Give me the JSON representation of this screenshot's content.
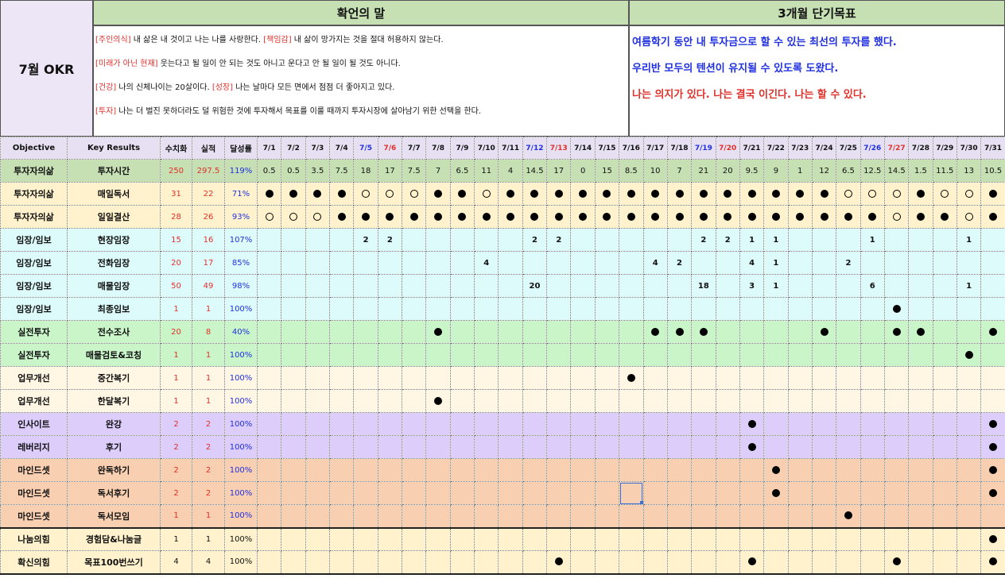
{
  "header": {
    "okr_title": "7월 OKR",
    "confirm_title": "확언의 말",
    "goal_title": "3개월 단기목표",
    "confirm_lines": [
      [
        {
          "t": "[주인의식]",
          "red": true
        },
        {
          "t": " 내 삶은 내 것이고 나는 나를 사랑한다. ",
          "red": false
        },
        {
          "t": "[책임감]",
          "red": true
        },
        {
          "t": " 내 삶이 망가지는 것을 절대 허용하지 않는다.",
          "red": false
        }
      ],
      [
        {
          "t": "[미래가 아닌 현재]",
          "red": true
        },
        {
          "t": " 웃는다고 될 일이 안 되는 것도 아니고 운다고 안 될 일이 될 것도 아니다.",
          "red": false
        }
      ],
      [
        {
          "t": "[건강]",
          "red": true
        },
        {
          "t": " 나의 신체나이는 20살이다. ",
          "red": false
        },
        {
          "t": "[성장]",
          "red": true
        },
        {
          "t": " 나는 날마다 모든 면에서 점점 더 좋아지고 있다.",
          "red": false
        }
      ],
      [
        {
          "t": "[투자]",
          "red": true
        },
        {
          "t": " 나는 더 벌진 못하더라도 덜 위험한 것에 투자해서 목표를 이룰 때까지 투자시장에 살아남기 위한 선택을 한다.",
          "red": false
        }
      ]
    ],
    "goals": [
      {
        "text": "여름학기 동안 내 투자금으로 할 수 있는 최선의 투자를 했다.",
        "color": "#2030e0"
      },
      {
        "text": "우리반 모두의 텐션이 유지될 수 있도록 도왔다.",
        "color": "#2030e0"
      },
      {
        "text": "나는 의지가 있다. 나는 결국 이긴다. 나는 할 수 있다.",
        "color": "#e0302a"
      }
    ]
  },
  "columns": {
    "objective": "Objective",
    "key_results": "Key Results",
    "numeric": "수치화",
    "actual": "실적",
    "rate": "달성률"
  },
  "dates": [
    "7/1",
    "7/2",
    "7/3",
    "7/4",
    "7/5",
    "7/6",
    "7/7",
    "7/8",
    "7/9",
    "7/10",
    "7/11",
    "7/12",
    "7/13",
    "7/14",
    "7/15",
    "7/16",
    "7/17",
    "7/18",
    "7/19",
    "7/20",
    "7/21",
    "7/22",
    "7/23",
    "7/24",
    "7/25",
    "7/26",
    "7/27",
    "7/28",
    "7/29",
    "7/30",
    "7/31"
  ],
  "date_colors": {
    "sat": [
      4,
      11,
      18,
      25
    ],
    "sun": [
      5,
      12,
      19,
      26
    ]
  },
  "rows": [
    {
      "obj": "투자자의삶",
      "kr": "투자시간",
      "num": "250",
      "act": "297.5",
      "rate": "119%",
      "bg": "#c6e0b4",
      "cells": [
        "0.5",
        "0.5",
        "3.5",
        "7.5",
        "18",
        "17",
        "7.5",
        "7",
        "6.5",
        "11",
        "4",
        "14.5",
        "17",
        "0",
        "15",
        "8.5",
        "10",
        "7",
        "21",
        "20",
        "9.5",
        "9",
        "1",
        "12",
        "6.5",
        "12.5",
        "14.5",
        "1.5",
        "11.5",
        "13",
        "10.5"
      ]
    },
    {
      "obj": "투자자의삶",
      "kr": "매일독서",
      "num": "31",
      "act": "22",
      "rate": "71%",
      "bg": "#fff2cc",
      "cells": [
        "D",
        "D",
        "D",
        "D",
        "O",
        "O",
        "O",
        "D",
        "D",
        "O",
        "D",
        "D",
        "D",
        "D",
        "D",
        "D",
        "D",
        "D",
        "D",
        "D",
        "D",
        "D",
        "D",
        "D",
        "O",
        "O",
        "O",
        "D",
        "O",
        "O",
        "D"
      ]
    },
    {
      "obj": "투자자의삶",
      "kr": "일일결산",
      "num": "28",
      "act": "26",
      "rate": "93%",
      "bg": "#fff2cc",
      "cells": [
        "O",
        "O",
        "O",
        "D",
        "D",
        "D",
        "D",
        "D",
        "D",
        "D",
        "D",
        "D",
        "D",
        "D",
        "D",
        "D",
        "D",
        "D",
        "D",
        "D",
        "D",
        "D",
        "D",
        "D",
        "D",
        "D",
        "O",
        "D",
        "D",
        "O",
        "D"
      ]
    },
    {
      "obj": "임장/임보",
      "kr": "현장임장",
      "num": "15",
      "act": "16",
      "rate": "107%",
      "bg": "#ddfbfb",
      "cells": [
        "",
        "",
        "",
        "",
        "2",
        "2",
        "",
        "",
        "",
        "",
        "",
        "2",
        "2",
        "",
        "",
        "",
        "",
        "",
        "2",
        "2",
        "1",
        "1",
        "",
        "",
        "",
        "1",
        "",
        "",
        "",
        "1",
        ""
      ]
    },
    {
      "obj": "임장/임보",
      "kr": "전화임장",
      "num": "20",
      "act": "17",
      "rate": "85%",
      "bg": "#ddfbfb",
      "cells": [
        "",
        "",
        "",
        "",
        "",
        "",
        "",
        "",
        "",
        "4",
        "",
        "",
        "",
        "",
        "",
        "",
        "4",
        "2",
        "",
        "",
        "4",
        "1",
        "",
        "",
        "2",
        "",
        "",
        "",
        "",
        "",
        ""
      ]
    },
    {
      "obj": "임장/임보",
      "kr": "매물임장",
      "num": "50",
      "act": "49",
      "rate": "98%",
      "bg": "#ddfbfb",
      "cells": [
        "",
        "",
        "",
        "",
        "",
        "",
        "",
        "",
        "",
        "",
        "",
        "20",
        "",
        "",
        "",
        "",
        "",
        "",
        "18",
        "",
        "3",
        "1",
        "",
        "",
        "",
        "6",
        "",
        "",
        "",
        "1",
        ""
      ]
    },
    {
      "obj": "임장/임보",
      "kr": "최종임보",
      "num": "1",
      "act": "1",
      "rate": "100%",
      "bg": "#ddfbfb",
      "cells": [
        "",
        "",
        "",
        "",
        "",
        "",
        "",
        "",
        "",
        "",
        "",
        "",
        "",
        "",
        "",
        "",
        "",
        "",
        "",
        "",
        "",
        "",
        "",
        "",
        "",
        "",
        "D",
        "",
        "",
        "",
        ""
      ]
    },
    {
      "obj": "실전투자",
      "kr": "전수조사",
      "num": "20",
      "act": "8",
      "rate": "40%",
      "bg": "#c9f5c9",
      "cells": [
        "",
        "",
        "",
        "",
        "",
        "",
        "",
        "D",
        "",
        "",
        "",
        "",
        "",
        "",
        "",
        "",
        "D",
        "D",
        "D",
        "",
        "",
        "",
        "",
        "D",
        "",
        "",
        "D",
        "D",
        "",
        "",
        "D"
      ]
    },
    {
      "obj": "실전투자",
      "kr": "매물검토&코칭",
      "num": "1",
      "act": "1",
      "rate": "100%",
      "bg": "#c9f5c9",
      "cells": [
        "",
        "",
        "",
        "",
        "",
        "",
        "",
        "",
        "",
        "",
        "",
        "",
        "",
        "",
        "",
        "",
        "",
        "",
        "",
        "",
        "",
        "",
        "",
        "",
        "",
        "",
        "",
        "",
        "",
        "D",
        ""
      ]
    },
    {
      "obj": "업무개선",
      "kr": "중간복기",
      "num": "1",
      "act": "1",
      "rate": "100%",
      "bg": "#fff6e3",
      "cells": [
        "",
        "",
        "",
        "",
        "",
        "",
        "",
        "",
        "",
        "",
        "",
        "",
        "",
        "",
        "",
        "D",
        "",
        "",
        "",
        "",
        "",
        "",
        "",
        "",
        "",
        "",
        "",
        "",
        "",
        "",
        ""
      ]
    },
    {
      "obj": "업무개선",
      "kr": "한달복기",
      "num": "1",
      "act": "1",
      "rate": "100%",
      "bg": "#fff6e3",
      "cells": [
        "",
        "",
        "",
        "",
        "",
        "",
        "",
        "D",
        "",
        "",
        "",
        "",
        "",
        "",
        "",
        "",
        "",
        "",
        "",
        "",
        "",
        "",
        "",
        "",
        "",
        "",
        "",
        "",
        "",
        "",
        ""
      ]
    },
    {
      "obj": "인사이트",
      "kr": "완강",
      "num": "2",
      "act": "2",
      "rate": "100%",
      "bg": "#dccdfb",
      "cells": [
        "",
        "",
        "",
        "",
        "",
        "",
        "",
        "",
        "",
        "",
        "",
        "",
        "",
        "",
        "",
        "",
        "",
        "",
        "",
        "",
        "D",
        "",
        "",
        "",
        "",
        "",
        "",
        "",
        "",
        "",
        "D"
      ]
    },
    {
      "obj": "레버리지",
      "kr": "후기",
      "num": "2",
      "act": "2",
      "rate": "100%",
      "bg": "#dccdfb",
      "cells": [
        "",
        "",
        "",
        "",
        "",
        "",
        "",
        "",
        "",
        "",
        "",
        "",
        "",
        "",
        "",
        "",
        "",
        "",
        "",
        "",
        "D",
        "",
        "",
        "",
        "",
        "",
        "",
        "",
        "",
        "",
        "D"
      ]
    },
    {
      "obj": "마인드셋",
      "kr": "완독하기",
      "num": "2",
      "act": "2",
      "rate": "100%",
      "bg": "#f8cfb0",
      "cells": [
        "",
        "",
        "",
        "",
        "",
        "",
        "",
        "",
        "",
        "",
        "",
        "",
        "",
        "",
        "",
        "",
        "",
        "",
        "",
        "",
        "",
        "D",
        "",
        "",
        "",
        "",
        "",
        "",
        "",
        "",
        "D"
      ]
    },
    {
      "obj": "마인드셋",
      "kr": "독서후기",
      "num": "2",
      "act": "2",
      "rate": "100%",
      "bg": "#f8cfb0",
      "cells": [
        "",
        "",
        "",
        "",
        "",
        "",
        "",
        "",
        "",
        "",
        "",
        "",
        "",
        "",
        "",
        "S",
        "",
        "",
        "",
        "",
        "",
        "D",
        "",
        "",
        "",
        "",
        "",
        "",
        "",
        "",
        "D"
      ]
    },
    {
      "obj": "마인드셋",
      "kr": "독서모임",
      "num": "1",
      "act": "1",
      "rate": "100%",
      "bg": "#f8cfb0",
      "cells": [
        "",
        "",
        "",
        "",
        "",
        "",
        "",
        "",
        "",
        "",
        "",
        "",
        "",
        "",
        "",
        "",
        "",
        "",
        "",
        "",
        "",
        "",
        "",
        "",
        "D",
        "",
        "",
        "",
        "",
        "",
        ""
      ]
    },
    {
      "obj": "나눔의힘",
      "kr": "경험담&나눔글",
      "num": "1",
      "act": "1",
      "rate": "100%",
      "bg": "#fff2cc",
      "plain": true,
      "cells": [
        "",
        "",
        "",
        "",
        "",
        "",
        "",
        "",
        "",
        "",
        "",
        "",
        "",
        "",
        "",
        "",
        "",
        "",
        "",
        "",
        "",
        "",
        "",
        "",
        "",
        "",
        "",
        "",
        "",
        "",
        "D"
      ]
    },
    {
      "obj": "확신의힘",
      "kr": "목표100번쓰기",
      "num": "4",
      "act": "4",
      "rate": "100%",
      "bg": "#fff2cc",
      "plain": true,
      "cells": [
        "",
        "",
        "",
        "",
        "",
        "",
        "",
        "",
        "",
        "",
        "",
        "",
        "D",
        "",
        "",
        "",
        "",
        "",
        "",
        "",
        "D",
        "",
        "",
        "",
        "",
        "",
        "D",
        "",
        "",
        "",
        "D"
      ]
    }
  ]
}
